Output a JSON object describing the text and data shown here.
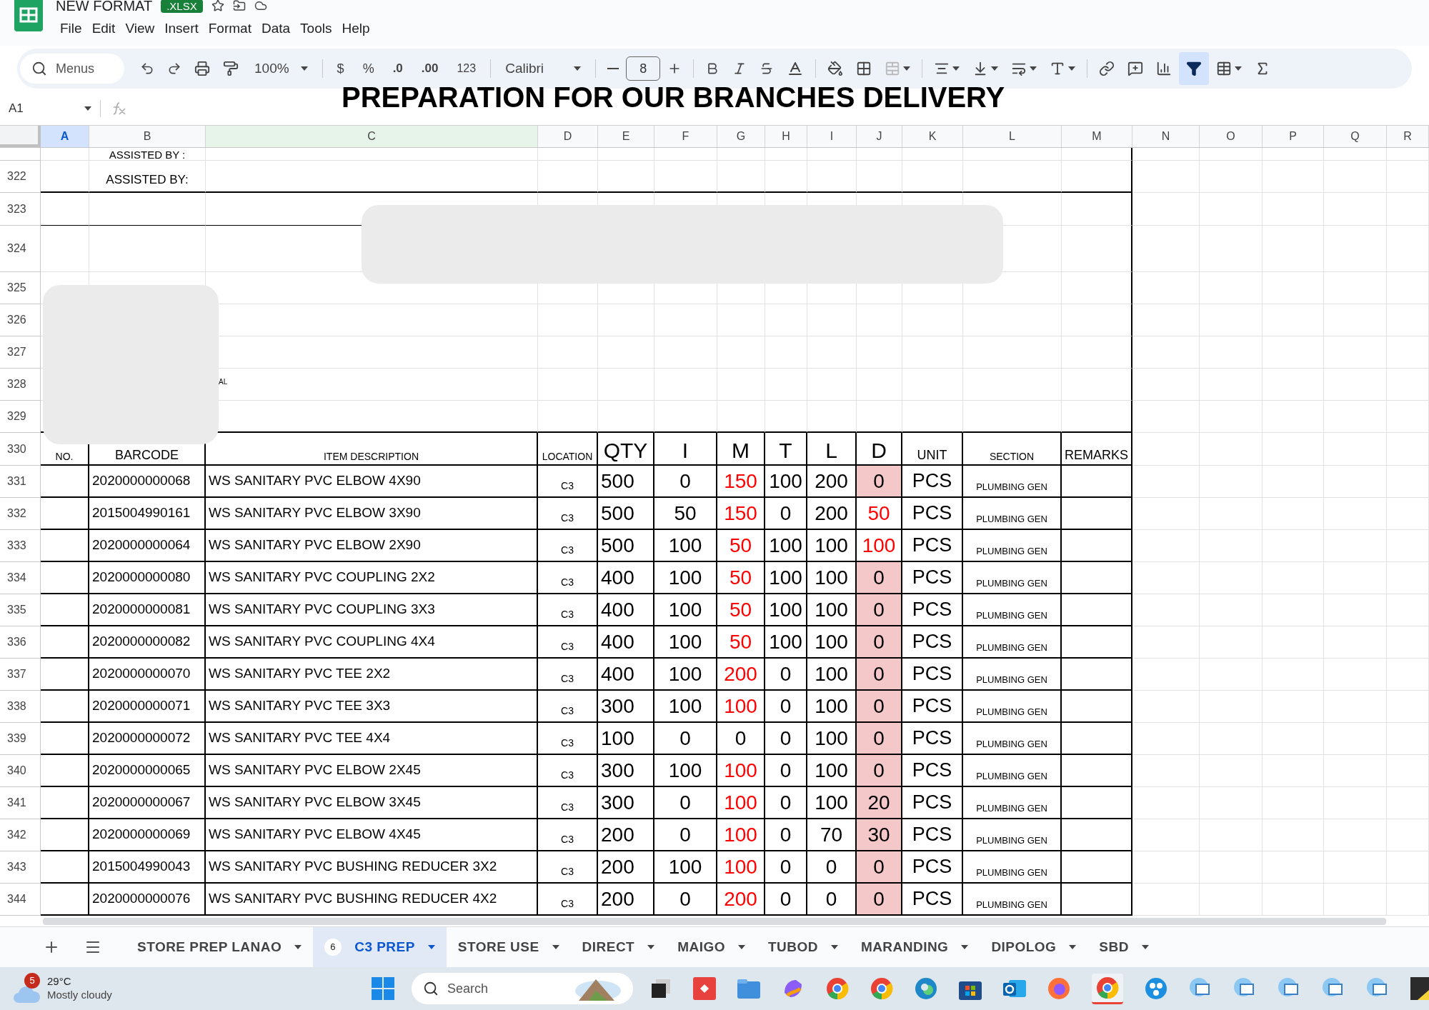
{
  "document": {
    "title": "NEW FORMAT",
    "badge": ".XLSX"
  },
  "menu": [
    "File",
    "Edit",
    "View",
    "Insert",
    "Format",
    "Data",
    "Tools",
    "Help"
  ],
  "toolbar": {
    "search": "Menus",
    "zoom": "100%",
    "currency": "$",
    "percent": "%",
    "decrease_decimal": ".0",
    "increase_decimal": ".00",
    "number_format": "123",
    "font": "Calibri",
    "font_size": "8",
    "filter_on": true
  },
  "formula_bar": {
    "cell_ref": "A1"
  },
  "banner": "PREPARATION FOR OUR BRANCHES DELIVERY",
  "columns": [
    {
      "label": "A",
      "selected": true,
      "filtered": false
    },
    {
      "label": "B",
      "selected": false,
      "filtered": false
    },
    {
      "label": "C",
      "selected": false,
      "filtered": true
    },
    {
      "label": "D",
      "selected": false,
      "filtered": false
    },
    {
      "label": "E",
      "selected": false,
      "filtered": false
    },
    {
      "label": "F",
      "selected": false,
      "filtered": false
    },
    {
      "label": "G",
      "selected": false,
      "filtered": false
    },
    {
      "label": "H",
      "selected": false,
      "filtered": false
    },
    {
      "label": "I",
      "selected": false,
      "filtered": false
    },
    {
      "label": "J",
      "selected": false,
      "filtered": false
    },
    {
      "label": "K",
      "selected": false,
      "filtered": false
    },
    {
      "label": "L",
      "selected": false,
      "filtered": false
    },
    {
      "label": "M",
      "selected": false,
      "filtered": false
    },
    {
      "label": "N",
      "selected": false,
      "filtered": false
    },
    {
      "label": "O",
      "selected": false,
      "filtered": false
    },
    {
      "label": "P",
      "selected": false,
      "filtered": false
    },
    {
      "label": "Q",
      "selected": false,
      "filtered": false
    },
    {
      "label": "R",
      "selected": false,
      "filtered": false
    }
  ],
  "upper_rows": [
    {
      "number": "",
      "text": "ASSISTED BY :"
    },
    {
      "number": "322",
      "text": "ASSISTED BY:"
    },
    {
      "number": "323"
    },
    {
      "number": "324"
    },
    {
      "number": "325"
    },
    {
      "number": "326"
    },
    {
      "number": "327"
    },
    {
      "number": "328",
      "text": "AL"
    },
    {
      "number": "329"
    }
  ],
  "table": {
    "header_row": "330",
    "headers": [
      {
        "label": "NO.",
        "kind": "small"
      },
      {
        "label": "BARCODE",
        "kind": "medium"
      },
      {
        "label": "ITEM DESCRIPTION",
        "kind": "small"
      },
      {
        "label": "LOCATION",
        "kind": "small"
      },
      {
        "label": "QTY",
        "kind": "large"
      },
      {
        "label": "I",
        "kind": "large"
      },
      {
        "label": "M",
        "kind": "large"
      },
      {
        "label": "T",
        "kind": "large"
      },
      {
        "label": "L",
        "kind": "large"
      },
      {
        "label": "D",
        "kind": "large"
      },
      {
        "label": "UNIT",
        "kind": "medium"
      },
      {
        "label": "SECTION",
        "kind": "small"
      },
      {
        "label": "REMARKS",
        "kind": "medium"
      }
    ],
    "rows": [
      {
        "number": "331",
        "barcode": "2020000000068",
        "description": "WS SANITARY PVC ELBOW 4X90",
        "location": "C3",
        "qty": "500",
        "i": "0",
        "m": "150",
        "t": "100",
        "l": "200",
        "d": "0",
        "unit": "PCS",
        "section": "PLUMBING GEN",
        "m_alert": true,
        "d_alert": false,
        "d_flag": true
      },
      {
        "number": "332",
        "barcode": "2015004990161",
        "description": "WS SANITARY PVC ELBOW 3X90",
        "location": "C3",
        "qty": "500",
        "i": "50",
        "m": "150",
        "t": "0",
        "l": "200",
        "d": "50",
        "unit": "PCS",
        "section": "PLUMBING GEN",
        "m_alert": true,
        "d_alert": true,
        "d_flag": false
      },
      {
        "number": "333",
        "barcode": "2020000000064",
        "description": "WS SANITARY PVC ELBOW 2X90",
        "location": "C3",
        "qty": "500",
        "i": "100",
        "m": "50",
        "t": "100",
        "l": "100",
        "d": "100",
        "unit": "PCS",
        "section": "PLUMBING GEN",
        "m_alert": true,
        "d_alert": true,
        "d_flag": false
      },
      {
        "number": "334",
        "barcode": "2020000000080",
        "description": "WS SANITARY PVC COUPLING 2X2",
        "location": "C3",
        "qty": "400",
        "i": "100",
        "m": "50",
        "t": "100",
        "l": "100",
        "d": "0",
        "unit": "PCS",
        "section": "PLUMBING GEN",
        "m_alert": true,
        "d_alert": false,
        "d_flag": true
      },
      {
        "number": "335",
        "barcode": "2020000000081",
        "description": "WS SANITARY PVC COUPLING 3X3",
        "location": "C3",
        "qty": "400",
        "i": "100",
        "m": "50",
        "t": "100",
        "l": "100",
        "d": "0",
        "unit": "PCS",
        "section": "PLUMBING GEN",
        "m_alert": true,
        "d_alert": false,
        "d_flag": true
      },
      {
        "number": "336",
        "barcode": "2020000000082",
        "description": "WS SANITARY PVC COUPLING 4X4",
        "location": "C3",
        "qty": "400",
        "i": "100",
        "m": "50",
        "t": "100",
        "l": "100",
        "d": "0",
        "unit": "PCS",
        "section": "PLUMBING GEN",
        "m_alert": true,
        "d_alert": false,
        "d_flag": true
      },
      {
        "number": "337",
        "barcode": "2020000000070",
        "description": "WS SANITARY PVC TEE 2X2",
        "location": "C3",
        "qty": "400",
        "i": "100",
        "m": "200",
        "t": "0",
        "l": "100",
        "d": "0",
        "unit": "PCS",
        "section": "PLUMBING GEN",
        "m_alert": true,
        "d_alert": false,
        "d_flag": true
      },
      {
        "number": "338",
        "barcode": "2020000000071",
        "description": "WS SANITARY PVC TEE 3X3",
        "location": "C3",
        "qty": "300",
        "i": "100",
        "m": "100",
        "t": "0",
        "l": "100",
        "d": "0",
        "unit": "PCS",
        "section": "PLUMBING GEN",
        "m_alert": true,
        "d_alert": false,
        "d_flag": true
      },
      {
        "number": "339",
        "barcode": "2020000000072",
        "description": "WS SANITARY PVC TEE 4X4",
        "location": "C3",
        "qty": "100",
        "i": "0",
        "m": "0",
        "t": "0",
        "l": "100",
        "d": "0",
        "unit": "PCS",
        "section": "PLUMBING GEN",
        "m_alert": false,
        "d_alert": false,
        "d_flag": true
      },
      {
        "number": "340",
        "barcode": "2020000000065",
        "description": "WS SANITARY PVC ELBOW 2X45",
        "location": "C3",
        "qty": "300",
        "i": "100",
        "m": "100",
        "t": "0",
        "l": "100",
        "d": "0",
        "unit": "PCS",
        "section": "PLUMBING GEN",
        "m_alert": true,
        "d_alert": false,
        "d_flag": true
      },
      {
        "number": "341",
        "barcode": "2020000000067",
        "description": "WS SANITARY PVC ELBOW 3X45",
        "location": "C3",
        "qty": "300",
        "i": "0",
        "m": "100",
        "t": "0",
        "l": "100",
        "d": "20",
        "unit": "PCS",
        "section": "PLUMBING GEN",
        "m_alert": true,
        "d_alert": false,
        "d_flag": true
      },
      {
        "number": "342",
        "barcode": "2020000000069",
        "description": "WS SANITARY PVC ELBOW 4X45",
        "location": "C3",
        "qty": "200",
        "i": "0",
        "m": "100",
        "t": "0",
        "l": "70",
        "d": "30",
        "unit": "PCS",
        "section": "PLUMBING GEN",
        "m_alert": true,
        "d_alert": false,
        "d_flag": true
      },
      {
        "number": "343",
        "barcode": "2015004990043",
        "description": "WS SANITARY PVC BUSHING REDUCER 3X2",
        "location": "C3",
        "qty": "200",
        "i": "100",
        "m": "100",
        "t": "0",
        "l": "0",
        "d": "0",
        "unit": "PCS",
        "section": "PLUMBING GEN",
        "m_alert": true,
        "d_alert": false,
        "d_flag": true
      },
      {
        "number": "344",
        "barcode": "2020000000076",
        "description": "WS SANITARY PVC BUSHING REDUCER 4X2",
        "location": "C3",
        "qty": "200",
        "i": "0",
        "m": "200",
        "t": "0",
        "l": "0",
        "d": "0",
        "unit": "PCS",
        "section": "PLUMBING GEN",
        "m_alert": true,
        "d_alert": false,
        "d_flag": true
      }
    ]
  },
  "sheets": [
    {
      "label": "STORE PREP LANAO",
      "selected": false
    },
    {
      "label": "C3 PREP",
      "selected": true,
      "badge": "6"
    },
    {
      "label": "STORE USE",
      "selected": false
    },
    {
      "label": "DIRECT",
      "selected": false
    },
    {
      "label": "MAIGO",
      "selected": false
    },
    {
      "label": "TUBOD",
      "selected": false
    },
    {
      "label": "MARANDING",
      "selected": false
    },
    {
      "label": "DIPOLOG",
      "selected": false
    },
    {
      "label": "SBD",
      "selected": false
    }
  ],
  "taskbar": {
    "weather_badge": "5",
    "temperature": "29°C",
    "condition": "Mostly cloudy",
    "search": "Search"
  }
}
